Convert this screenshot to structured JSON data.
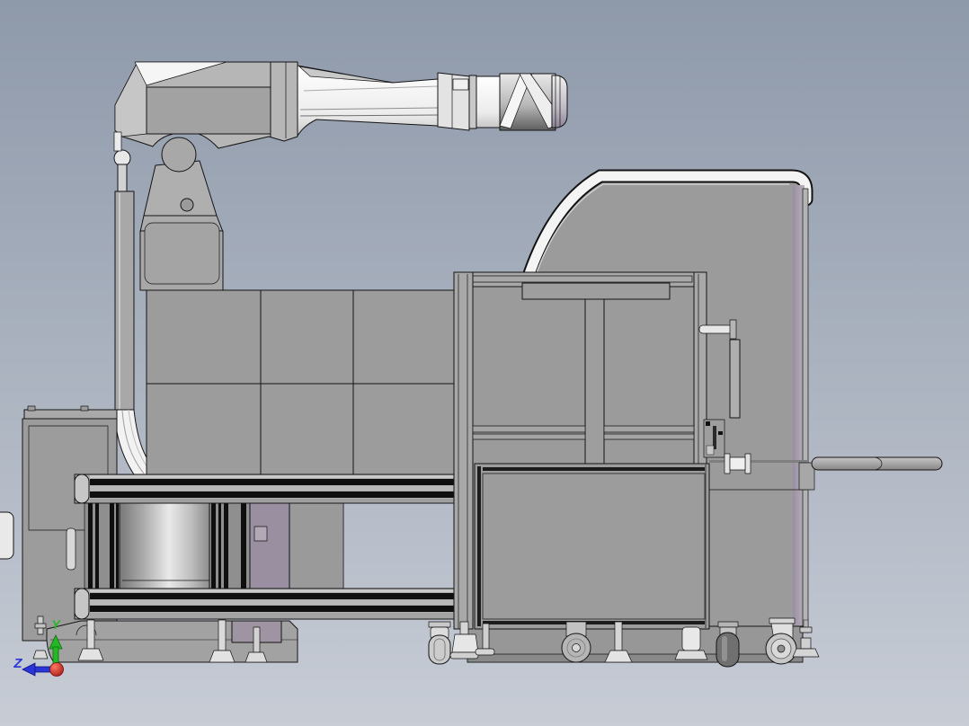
{
  "axis_triad": {
    "y_label": "Y",
    "z_label": "Z",
    "y_color": "#25b825",
    "z_color": "#2a35d8",
    "origin_color": "#c41818"
  },
  "colors": {
    "background_top": "#8e99aa",
    "background_bottom": "#c7ccd5",
    "machine_gray": "#9b9b9b",
    "machine_light_gray": "#b4b4b4",
    "machine_white": "#f4f4f4",
    "panel_dark_gray": "#a2a2a2",
    "accent_purple": "#9e93a2",
    "outline_black": "#141414"
  },
  "machine_parts": [
    "robot-arm",
    "robot-shoulder",
    "robot-wrist",
    "shoulder-bracket",
    "pedestal-column",
    "gas-spring-cylinder",
    "exhaust-duct",
    "panel-wall",
    "electrical-cabinet",
    "rotary-drum",
    "conveyor-frame-rails",
    "robot-base-plinth",
    "safety-fence-frame",
    "fence-door-panel",
    "machine-enclosure",
    "door-handle-bar",
    "latch-mechanism",
    "push-rod",
    "swivel-casters",
    "leveling-feet"
  ]
}
